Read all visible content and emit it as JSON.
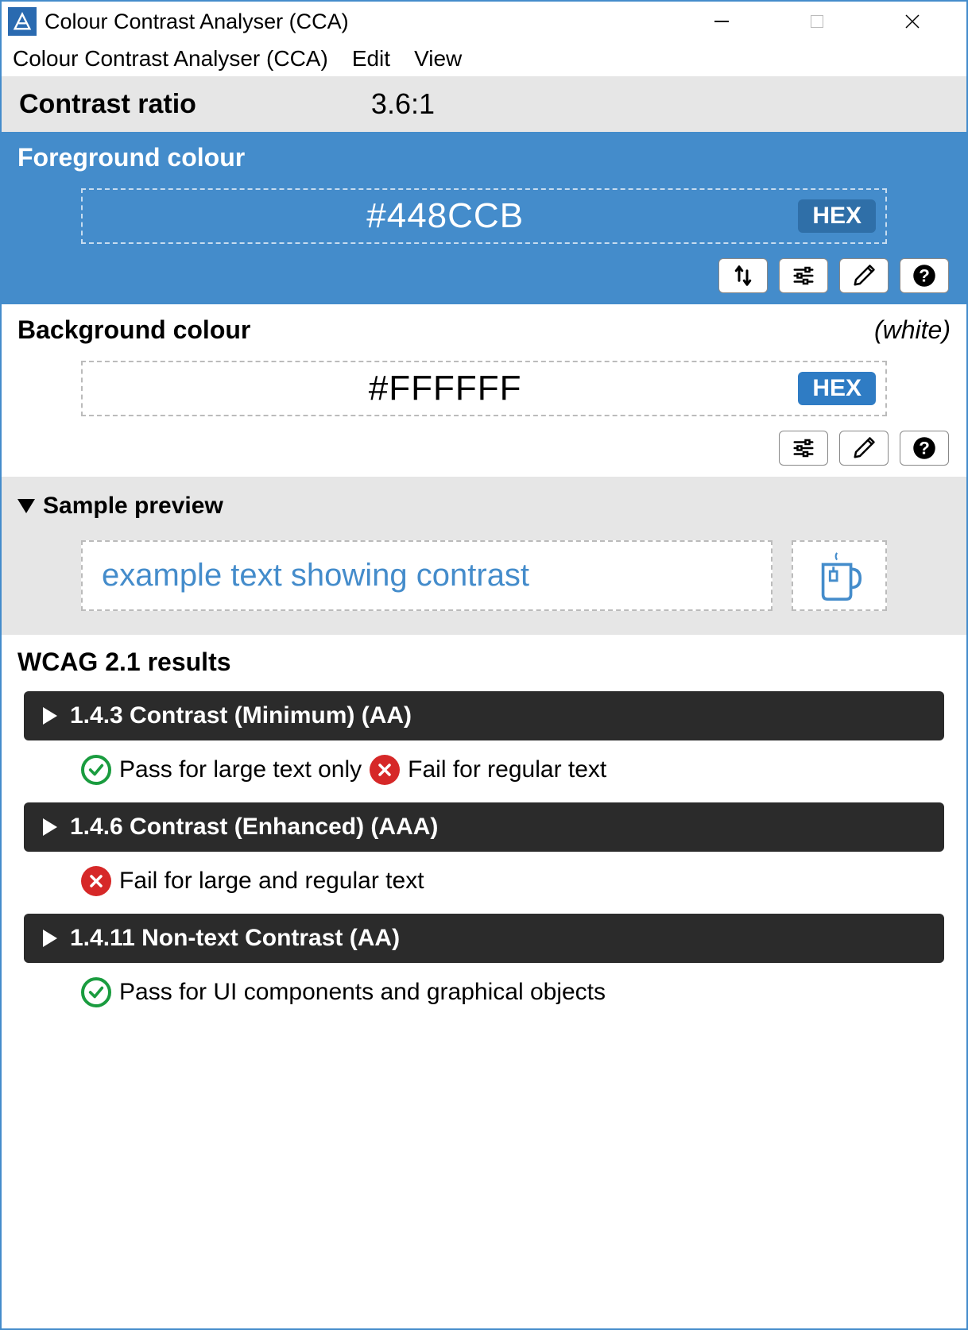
{
  "window": {
    "title": "Colour Contrast Analyser (CCA)"
  },
  "menu": {
    "items": [
      "Colour Contrast Analyser (CCA)",
      "Edit",
      "View"
    ]
  },
  "ratio": {
    "label": "Contrast ratio",
    "value": "3.6:1"
  },
  "foreground": {
    "heading": "Foreground colour",
    "value": "#448CCB",
    "format": "HEX",
    "color": "#448CCB"
  },
  "background": {
    "heading": "Background colour",
    "name": "(white)",
    "value": "#FFFFFF",
    "format": "HEX",
    "color": "#FFFFFF"
  },
  "preview": {
    "heading": "Sample preview",
    "text": "example text showing contrast"
  },
  "results": {
    "heading": "WCAG 2.1 results",
    "items": [
      {
        "title": "1.4.3 Contrast (Minimum) (AA)",
        "segments": [
          {
            "status": "pass",
            "text": "Pass for large text only"
          },
          {
            "status": "fail",
            "text": "Fail for regular text"
          }
        ]
      },
      {
        "title": "1.4.6 Contrast (Enhanced) (AAA)",
        "segments": [
          {
            "status": "fail",
            "text": "Fail for large and regular text"
          }
        ]
      },
      {
        "title": "1.4.11 Non-text Contrast (AA)",
        "segments": [
          {
            "status": "pass",
            "text": "Pass for UI components and graphical objects"
          }
        ]
      }
    ]
  }
}
